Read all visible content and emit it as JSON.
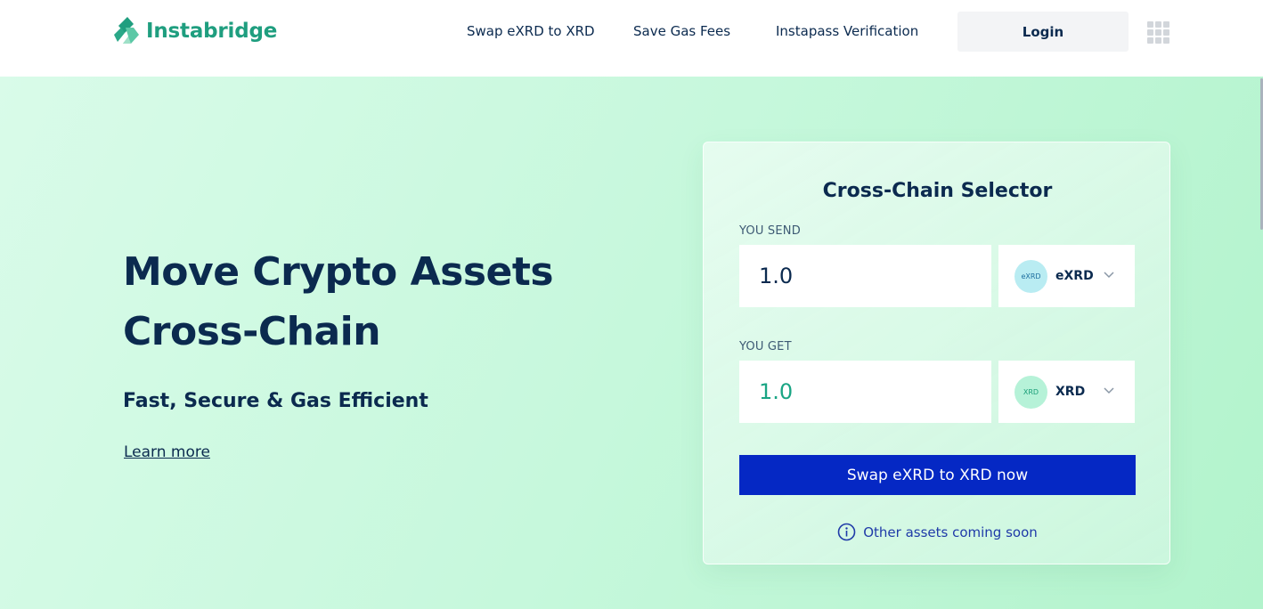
{
  "header": {
    "logo_text": "Instabridge",
    "nav": [
      {
        "label": "Swap eXRD to XRD"
      },
      {
        "label": "Save Gas Fees"
      },
      {
        "label": "Instapass Verification"
      }
    ],
    "login_label": "Login",
    "brand_color": "#1f9e7f"
  },
  "hero": {
    "title_line1": "Move Crypto Assets",
    "title_line2": "Cross-Chain",
    "subtitle": "Fast, Secure & Gas Efficient",
    "learn_more": "Learn more"
  },
  "selector": {
    "title": "Cross-Chain Selector",
    "send_label": "YOU SEND",
    "send_amount": "1.0",
    "send_asset": {
      "icon_text": "eXRD",
      "name": "eXRD"
    },
    "get_label": "YOU GET",
    "get_amount": "1.0",
    "get_asset": {
      "icon_text": "XRD",
      "name": "XRD"
    },
    "swap_button": "Swap eXRD to XRD now",
    "coming_soon": "Other assets coming soon",
    "accent_color": "#0528c4"
  }
}
